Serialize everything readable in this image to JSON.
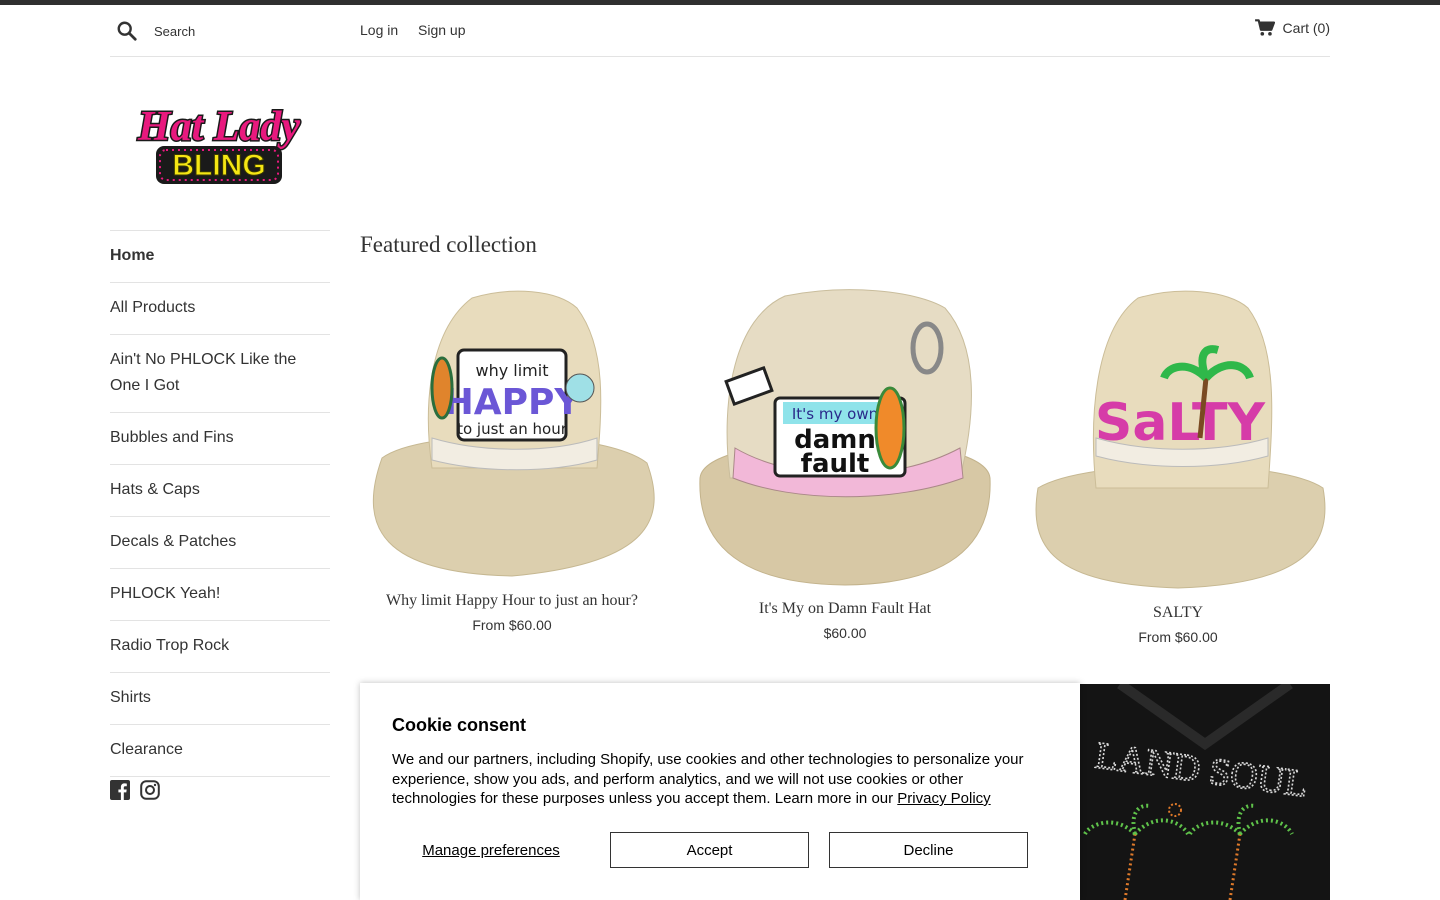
{
  "header": {
    "search_placeholder": "Search",
    "login": "Log in",
    "signup": "Sign up",
    "cart": "Cart (0)"
  },
  "logo": {
    "line1": "Hat Lady",
    "line2": "BLING",
    "colors": {
      "pink": "#e8197e",
      "yellow": "#f5e614",
      "dark": "#1a1a1a"
    }
  },
  "sidebar": {
    "items": [
      {
        "label": "Home",
        "active": true
      },
      {
        "label": "All Products"
      },
      {
        "label": "Ain't No PHLOCK Like the One I Got"
      },
      {
        "label": "Bubbles and Fins"
      },
      {
        "label": "Hats & Caps"
      },
      {
        "label": "Decals & Patches"
      },
      {
        "label": "PHLOCK Yeah!"
      },
      {
        "label": "Radio Trop Rock"
      },
      {
        "label": "Shirts"
      },
      {
        "label": "Clearance"
      }
    ],
    "social": [
      "facebook-icon",
      "instagram-icon"
    ]
  },
  "featured": {
    "title": "Featured collection",
    "products": [
      {
        "title": "Why limit Happy Hour to just an hour?",
        "price": "From $60.00",
        "patch_lines": [
          "why limit",
          "HAPPY",
          "to just an hour"
        ]
      },
      {
        "title": "It's My on Damn Fault Hat",
        "price": "$60.00",
        "patch_lines": [
          "It's my own",
          "damn",
          "fault"
        ]
      },
      {
        "title": "SALTY",
        "price": "From $60.00",
        "patch_lines": [
          "SaLTY"
        ]
      }
    ],
    "shirt_text": "LAND SOUL"
  },
  "cookie": {
    "title": "Cookie consent",
    "body": "We and our partners, including Shopify, use cookies and other technologies to personalize your experience, show you ads, and perform analytics, and we will not use cookies or other technologies for these purposes unless you accept them. Learn more in our ",
    "privacy_link": "Privacy Policy",
    "manage": "Manage preferences",
    "accept": "Accept",
    "decline": "Decline"
  }
}
